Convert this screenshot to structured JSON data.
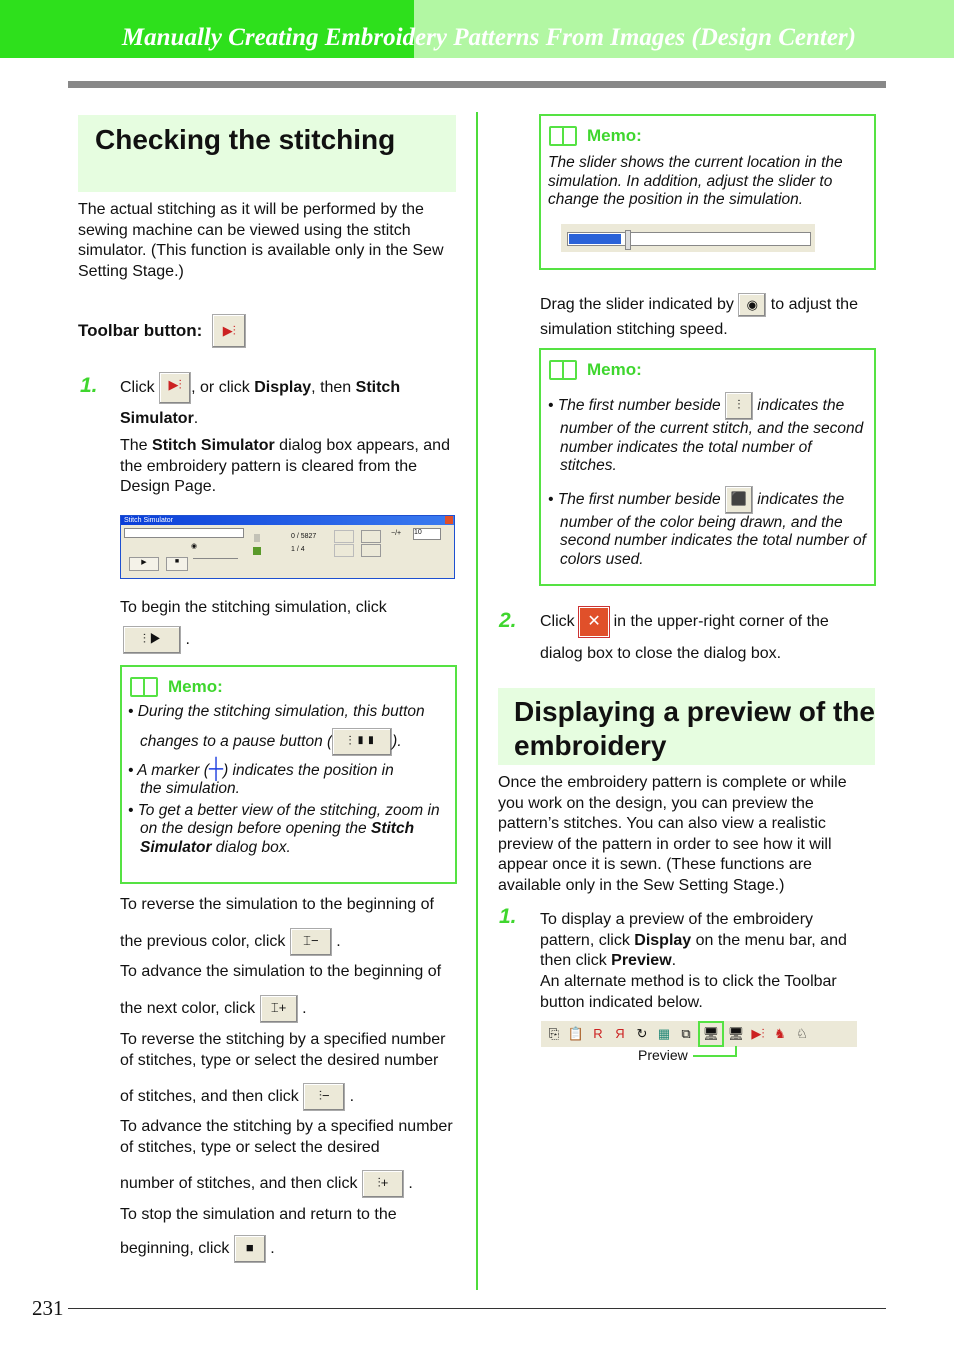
{
  "header": {
    "title": "Manually Creating Embroidery Patterns From Images (Design Center)"
  },
  "left": {
    "section_title": "Checking the stitching",
    "intro": "The actual stitching as it will be performed by the sewing machine can be viewed using the stitch simulator. (This function is available only in the Sew Setting Stage.)",
    "toolbar_label": "Toolbar button:",
    "step1": {
      "num": "1.",
      "a": "Click",
      "b": ", or click",
      "c": "Display",
      "d": ", then",
      "e": "Stitch Simulator",
      "f": ".",
      "g1": "The",
      "g2": "Stitch Simulator",
      "g3": "dialog box appears, and the embroidery pattern is cleared from the Design Page."
    },
    "dialog": {
      "title": "Stitch Simulator",
      "stitch_count": "0 / 5827",
      "color_count": "1 / 4",
      "step_value": "10",
      "step_label": "−/+"
    },
    "begin": "To begin the stitching simulation, click",
    "memo": {
      "title": "Memo:",
      "b1a": "• During the stitching simulation, this button",
      "b1b": "changes to a pause button (",
      "b1c": ").",
      "b2a": "• A marker (",
      "b2b": ") indicates the position in",
      "b2c": "the simulation.",
      "b3a": "• To get a better view of the stitching, zoom in on the design before opening the",
      "b3b": "Stitch",
      "b3c": "Simulator",
      "b3d": "dialog box."
    },
    "p1a": "To reverse the simulation to the beginning of",
    "p1b": "the previous color, click",
    "p2a": "To advance the simulation to the beginning of",
    "p2b": "the next color, click",
    "p3a": "To reverse the stitching by a specified number of stitches, type or select the desired number",
    "p3b": "of stitches, and then click",
    "p4a": "To advance the stitching by a specified number of stitches, type or select the desired",
    "p4b": "number of stitches, and then click",
    "p5a": "To stop the simulation and return to the",
    "p5b": "beginning, click",
    "period": "."
  },
  "right": {
    "memo1": {
      "title": "Memo:",
      "text": "The slider shows the current location in the simulation. In addition, adjust the slider to change the position in the simulation."
    },
    "drag_a": "Drag the slider indicated by",
    "drag_b": "to adjust the",
    "drag_c": "simulation stitching speed.",
    "memo2": {
      "title": "Memo:",
      "b1a": "• The first number beside",
      "b1b": "indicates the",
      "b1c": "number of the current stitch, and the second number indicates the total number of stitches.",
      "b2a": "• The first number beside",
      "b2b": "indicates the",
      "b2c": "number of the color being drawn, and the second number indicates the total number of colors used."
    },
    "step2": {
      "num": "2.",
      "a": "Click",
      "b": "in the upper-right corner of the",
      "c": "dialog box to close the dialog box."
    },
    "section_title": "Displaying a preview of the embroidery",
    "intro": "Once the embroidery pattern is complete or while you work on the design, you can preview the pattern’s stitches. You can also view a realistic preview of the pattern in order to see how it will appear once it is sewn. (These functions are available only in the Sew Setting Stage.)",
    "step1": {
      "num": "1.",
      "a": "To display a preview of the embroidery pattern, click",
      "b": "Display",
      "c": "on the menu bar, and then click",
      "d": "Preview",
      "e": ".",
      "f": "An alternate method is to click the Toolbar button indicated below."
    },
    "toolbar_callout": "Preview"
  },
  "footer": {
    "page": "231"
  },
  "colors": {
    "accent": "#3fd62e",
    "header": "#2ee01c",
    "section_bg": "#e6fde0"
  }
}
